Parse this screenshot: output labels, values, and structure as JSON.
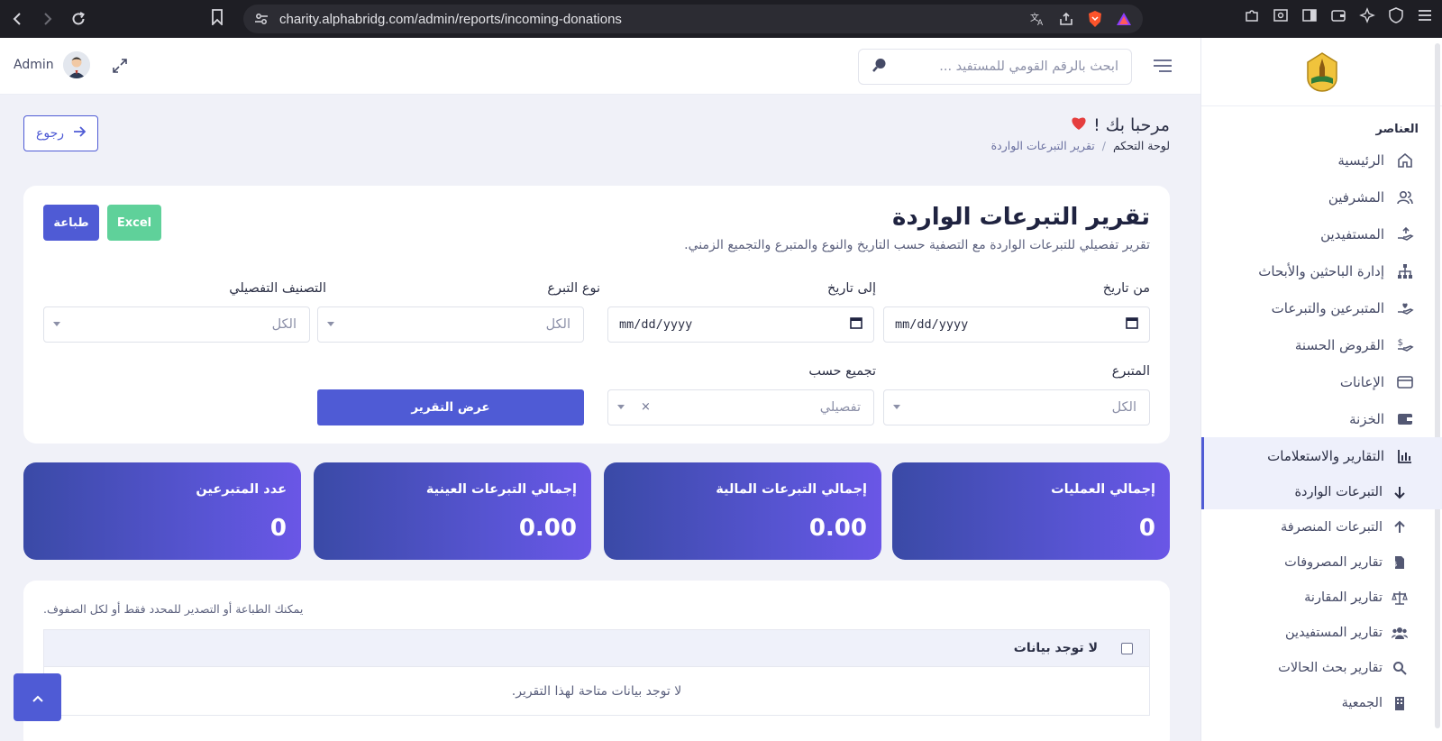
{
  "browser": {
    "url": "charity.alphabridg.com/admin/reports/incoming-donations"
  },
  "header": {
    "user_name": "Admin",
    "search_placeholder": "ابحث بالرقم القومي للمستفيد ..."
  },
  "sidebar": {
    "section_title": "العناصر",
    "items": [
      {
        "label": "الرئيسية",
        "icon": "home-icon"
      },
      {
        "label": "المشرفين",
        "icon": "users-icon"
      },
      {
        "label": "المستفيدين",
        "icon": "hand-give-icon"
      },
      {
        "label": "إدارة الباحثين والأبحاث",
        "icon": "sitemap-icon"
      },
      {
        "label": "المتبرعين والتبرعات",
        "icon": "hand-heart-icon"
      },
      {
        "label": "القروض الحسنة",
        "icon": "hand-dollar-icon"
      },
      {
        "label": "الإعانات",
        "icon": "card-icon"
      },
      {
        "label": "الخزنة",
        "icon": "wallet-icon"
      },
      {
        "label": "التقارير والاستعلامات",
        "icon": "chart-icon"
      }
    ],
    "sub_items": [
      {
        "label": "التبرعات الواردة",
        "icon": "arrow-down-icon"
      },
      {
        "label": "التبرعات المنصرفة",
        "icon": "arrow-up-icon"
      },
      {
        "label": "تقارير المصروفات",
        "icon": "invoice-icon"
      },
      {
        "label": "تقارير المقارنة",
        "icon": "scale-icon"
      },
      {
        "label": "تقارير المستفيدين",
        "icon": "group-icon"
      },
      {
        "label": "تقارير بحث الحالات",
        "icon": "search-icon"
      },
      {
        "label": "الجمعية",
        "icon": "building-icon"
      }
    ]
  },
  "page": {
    "welcome": "مرحبا بك !",
    "breadcrumb_root": "لوحة التحكم",
    "breadcrumb_sep": "/",
    "breadcrumb_current": "تقرير التبرعات الواردة",
    "back_label": "رجوع"
  },
  "report": {
    "title": "تقرير التبرعات الواردة",
    "subtitle": "تقرير تفصيلي للتبرعات الواردة مع التصفية حسب التاريخ والنوع والمتبرع والتجميع الزمني.",
    "print_label": "طباعة",
    "excel_label": "Excel",
    "filters": {
      "from_date_label": "من تاريخ",
      "from_date_value": "mm/dd/yyyy",
      "to_date_label": "إلى تاريخ",
      "to_date_value": "mm/dd/yyyy",
      "type_label": "نوع التبرع",
      "type_value": "الكل",
      "category_label": "التصنيف التفصيلي",
      "category_value": "الكل",
      "donor_label": "المتبرع",
      "donor_value": "الكل",
      "group_label": "تجميع حسب",
      "group_value": "تفصيلي",
      "clear_symbol": "×",
      "show_label": "عرض التقرير"
    }
  },
  "stats": [
    {
      "label": "إجمالي العمليات",
      "value": "0"
    },
    {
      "label": "إجمالي التبرعات المالية",
      "value": "0.00"
    },
    {
      "label": "إجمالي التبرعات العينية",
      "value": "0.00"
    },
    {
      "label": "عدد المتبرعين",
      "value": "0"
    }
  ],
  "table": {
    "hint": "يمكنك الطباعة أو التصدير للمحدد فقط أو لكل الصفوف.",
    "header": "لا توجد بيانات",
    "empty": "لا توجد بيانات متاحة لهذا التقرير."
  },
  "colors": {
    "primary": "#4f5bd5",
    "excel": "#5fd19a",
    "stat_gradient_start": "#3a4aa6",
    "stat_gradient_end": "#6a56e6"
  }
}
